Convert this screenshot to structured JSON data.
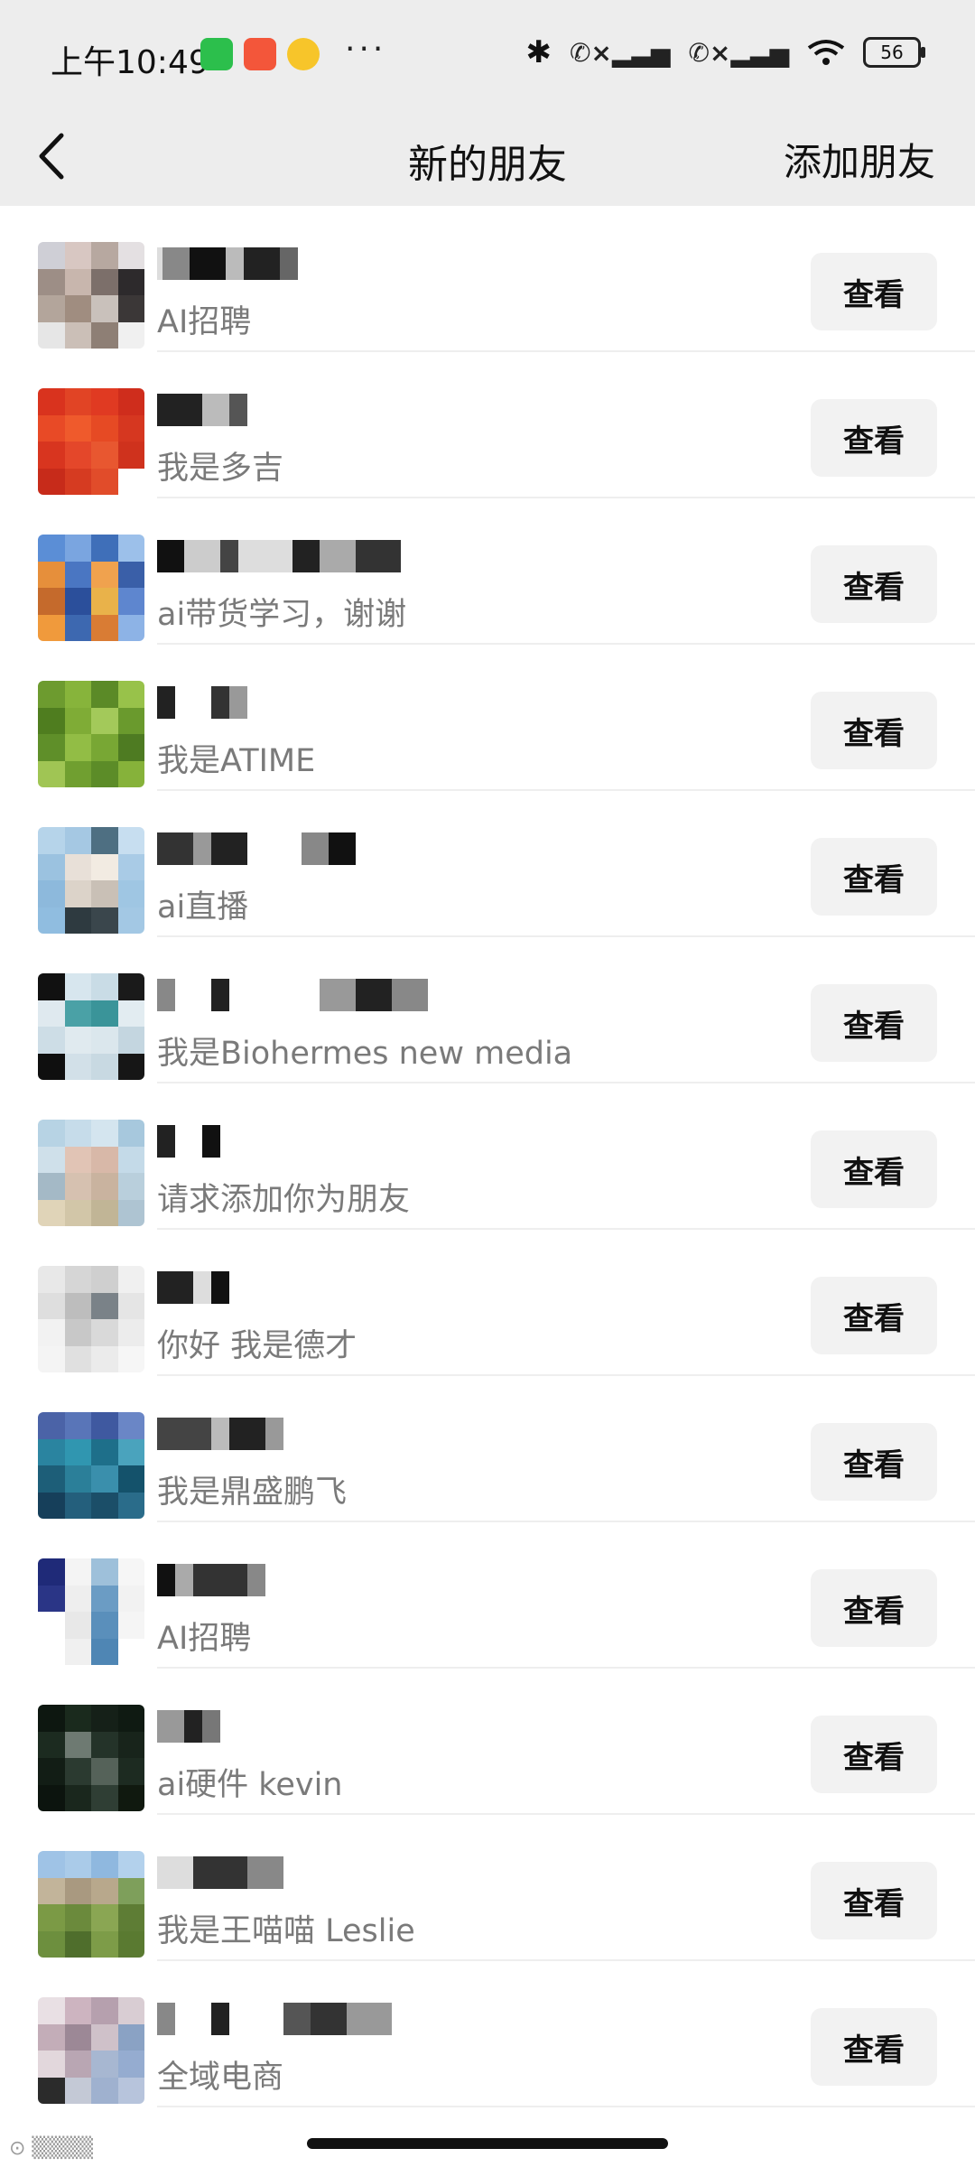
{
  "status_bar": {
    "time": "上午10:49",
    "icons": [
      "wechat-icon",
      "app-icon",
      "weibo-icon"
    ],
    "more": "···",
    "battery": "56"
  },
  "header": {
    "title": "新的朋友",
    "add_friend": "添加朋友"
  },
  "requests": [
    {
      "message": "AI招聘",
      "button": "查看",
      "avatar_colors": [
        "#cfcfd6",
        "#d8c7c2",
        "#b7a8a0",
        "#e4e0e2",
        "#9d8e86",
        "#c8b6ad",
        "#7c6f6a",
        "#2d2a2c",
        "#b3a59b",
        "#a08d80",
        "#c9c1bb",
        "#3b3737",
        "#e6e6e6",
        "#cbbfb7",
        "#8e7f75",
        "#f0f0f0"
      ]
    },
    {
      "message": "我是多吉",
      "button": "查看",
      "avatar_colors": [
        "#d9331e",
        "#e14425",
        "#e03a22",
        "#cf2d1c",
        "#e84a26",
        "#ef5a2c",
        "#e64a24",
        "#d63720",
        "#d8351f",
        "#e4472a",
        "#e85730",
        "#cf321d",
        "#c72b1a",
        "#d63b21",
        "#e14c2a",
        "#ffffff"
      ]
    },
    {
      "message": "ai带货学习，谢谢",
      "button": "查看",
      "avatar_colors": [
        "#5b8ed6",
        "#7aa5e0",
        "#3f6fb9",
        "#9cc0ea",
        "#e68f3b",
        "#4a76c2",
        "#f0a24e",
        "#3a5fa8",
        "#c56a2c",
        "#2b4f9b",
        "#e9b24a",
        "#5e86cf",
        "#f09a3c",
        "#3d68b0",
        "#d97c34",
        "#8db3e6"
      ]
    },
    {
      "message": "我是ATIME",
      "button": "查看",
      "avatar_colors": [
        "#6d9b2f",
        "#87b43b",
        "#5b8a27",
        "#98c24a",
        "#4f7d1f",
        "#7fac36",
        "#a3c95a",
        "#6a9a2d",
        "#5f8f29",
        "#92bd45",
        "#78a734",
        "#4e7b22",
        "#a0c554",
        "#709f30",
        "#5c8c28",
        "#86b23a"
      ]
    },
    {
      "message": "ai直播",
      "button": "查看",
      "avatar_colors": [
        "#b6d4ea",
        "#a5c8e3",
        "#4e6f82",
        "#c7def0",
        "#9bc2e0",
        "#e8e0d8",
        "#f2ebe2",
        "#a9cbe6",
        "#8db9dc",
        "#dcd3c9",
        "#c9c0b6",
        "#9fc6e3",
        "#90bde0",
        "#2e3a40",
        "#3a464c",
        "#a3c8e4"
      ]
    },
    {
      "message": "我是Biohermes new media",
      "button": "查看",
      "avatar_colors": [
        "#111111",
        "#d7e6ee",
        "#c9dce6",
        "#1a1a1a",
        "#dfe9ef",
        "#4aa1a6",
        "#3a9499",
        "#e2ecf1",
        "#cddde6",
        "#e0eaef",
        "#dbe7ed",
        "#c4d6e0",
        "#0f0f0f",
        "#d2e0e8",
        "#c8d9e2",
        "#161616"
      ]
    },
    {
      "message": "请求添加你为朋友",
      "button": "查看",
      "avatar_colors": [
        "#b7d3e4",
        "#c6dcea",
        "#d4e5ef",
        "#a7c8dd",
        "#cfe0ea",
        "#e1c4b5",
        "#d8b8a8",
        "#c4dae8",
        "#a4b9c6",
        "#d6c1b0",
        "#c9b39f",
        "#b9cfdc",
        "#e0d4b8",
        "#d2c6a8",
        "#c1b596",
        "#aec4d2"
      ]
    },
    {
      "message": "你好 我是德才",
      "button": "查看",
      "avatar_colors": [
        "#e8e8e8",
        "#d6d6d6",
        "#cfcfcf",
        "#f0f0f0",
        "#dedede",
        "#bdbdbd",
        "#7a8288",
        "#e5e5e5",
        "#f2f2f2",
        "#c8c8c8",
        "#d9d9d9",
        "#ececec",
        "#f4f4f4",
        "#e0e0e0",
        "#ebebeb",
        "#f6f6f6"
      ]
    },
    {
      "message": "我是鼎盛鹏飞",
      "button": "查看",
      "avatar_colors": [
        "#4b63a7",
        "#5975b8",
        "#3f59a0",
        "#6a86c6",
        "#2a84a0",
        "#3096b0",
        "#1e6f8a",
        "#4aa3bd",
        "#1d5e78",
        "#2b7f99",
        "#3a8fac",
        "#14526b",
        "#163f5a",
        "#245f7c",
        "#1b4e68",
        "#2a6c8a"
      ]
    },
    {
      "message": "AI招聘",
      "button": "查看",
      "avatar_colors": [
        "#1f2a78",
        "#f4f4f4",
        "#9ec0da",
        "#f6f6f6",
        "#2a3586",
        "#eeeeee",
        "#6b9cc4",
        "#f2f2f2",
        "#ffffff",
        "#e8e8e8",
        "#5a8fbb",
        "#f5f5f5",
        "#ffffff",
        "#f0f0f0",
        "#4f86b4",
        "#ffffff"
      ]
    },
    {
      "message": "ai硬件 kevin",
      "button": "查看",
      "avatar_colors": [
        "#0d1710",
        "#1a2a1d",
        "#152018",
        "#0f1a12",
        "#1c2b20",
        "#6e7a72",
        "#243329",
        "#18241b",
        "#121d15",
        "#2b3a30",
        "#556259",
        "#1d2b21",
        "#0c140e",
        "#1a271d",
        "#2f3e34",
        "#10190f"
      ]
    },
    {
      "message": "我是王喵喵 Leslie",
      "button": "查看",
      "avatar_colors": [
        "#9fc3e6",
        "#aacbe9",
        "#8fb8df",
        "#b3d1ec",
        "#c2b49a",
        "#a99980",
        "#b8a88c",
        "#7e9f5b",
        "#7b9a45",
        "#6b8a3c",
        "#8aa653",
        "#5e7d35",
        "#6d8f3e",
        "#4f6e2c",
        "#7d9c48",
        "#5a7a31"
      ]
    },
    {
      "message": "全域电商",
      "button": "查看",
      "avatar_colors": [
        "#e9e0e4",
        "#cdb4c0",
        "#b6a0ae",
        "#d9cdd3",
        "#c3adb8",
        "#9c8896",
        "#cfc1c9",
        "#8aa2c4",
        "#e2d7dc",
        "#b9a6b3",
        "#a7b7d1",
        "#95acd0",
        "#2b2b2b",
        "#c4c9d6",
        "#9fb1cf",
        "#b7c4dc"
      ]
    }
  ]
}
